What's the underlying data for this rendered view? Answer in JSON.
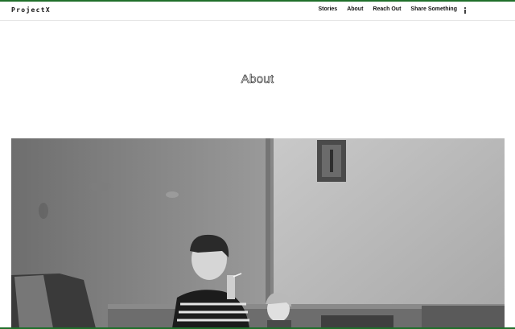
{
  "site": {
    "logo": "ProjectX"
  },
  "nav": {
    "items": [
      {
        "label": "Stories"
      },
      {
        "label": "About"
      },
      {
        "label": "Reach Out"
      },
      {
        "label": "Share Something"
      }
    ],
    "icon": "info-icon"
  },
  "page": {
    "title": "About"
  },
  "colors": {
    "accent_border": "#1f6f2a"
  }
}
